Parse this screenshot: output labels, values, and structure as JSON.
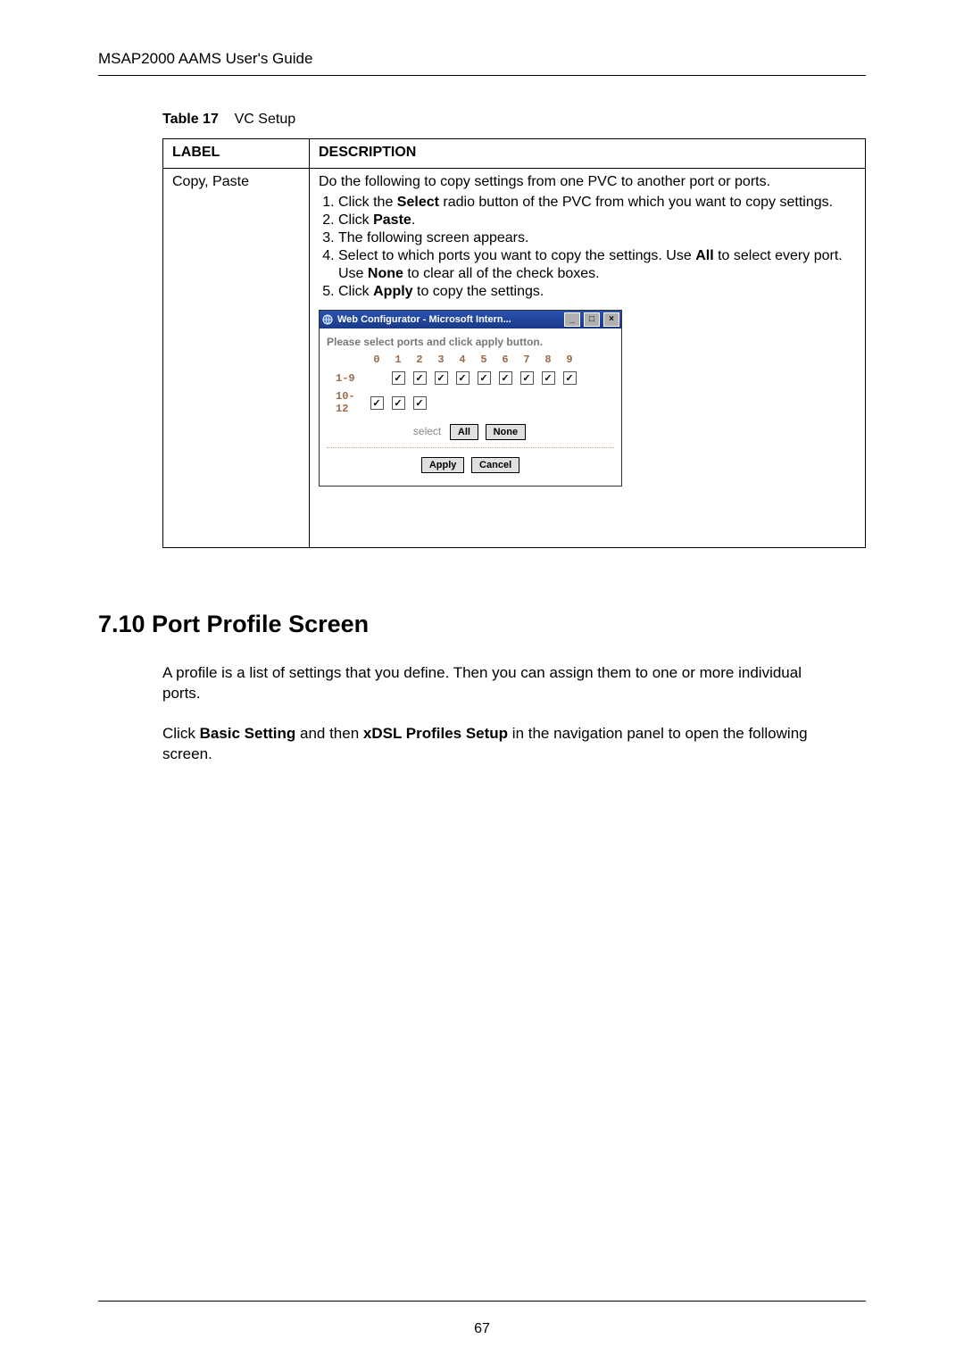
{
  "header": {
    "running_header": "MSAP2000 AAMS User's Guide"
  },
  "table_caption": {
    "label": "Table 17",
    "title": "VC Setup"
  },
  "table": {
    "head_label": "LABEL",
    "head_desc": "DESCRIPTION",
    "row_label": "Copy, Paste",
    "desc_intro": "Do the following to copy settings from one PVC to another port or ports.",
    "steps": {
      "s1a": "Click the ",
      "s1b": "Select",
      "s1c": " radio button of the PVC from which you want to copy settings.",
      "s2a": "Click ",
      "s2b": "Paste",
      "s2c": ".",
      "s3": "The following screen appears.",
      "s4a": "Select to which ports you want to copy the settings. Use ",
      "s4b": "All",
      "s4c": " to select every port. Use ",
      "s4d": "None",
      "s4e": " to clear all of the check boxes.",
      "s5a": "Click ",
      "s5b": "Apply",
      "s5c": " to copy the settings."
    }
  },
  "window": {
    "title": "Web Configurator - Microsoft Intern...",
    "prompt": "Please select ports and click apply button.",
    "col_headers": [
      "0",
      "1",
      "2",
      "3",
      "4",
      "5",
      "6",
      "7",
      "8",
      "9"
    ],
    "row1_label": "1-9",
    "row2_label": "10-12",
    "select_label": "select",
    "btn_all": "All",
    "btn_none": "None",
    "btn_apply": "Apply",
    "btn_cancel": "Cancel"
  },
  "section": {
    "heading": "7.10   Port Profile Screen",
    "p1": "A profile is a list of settings that you define. Then you can assign them to one or more individual ports.",
    "p2a": "Click ",
    "p2b": "Basic Setting",
    "p2c": " and then ",
    "p2d": "xDSL Profiles Setup",
    "p2e": " in the navigation panel to open the following screen."
  },
  "page_number": "67"
}
